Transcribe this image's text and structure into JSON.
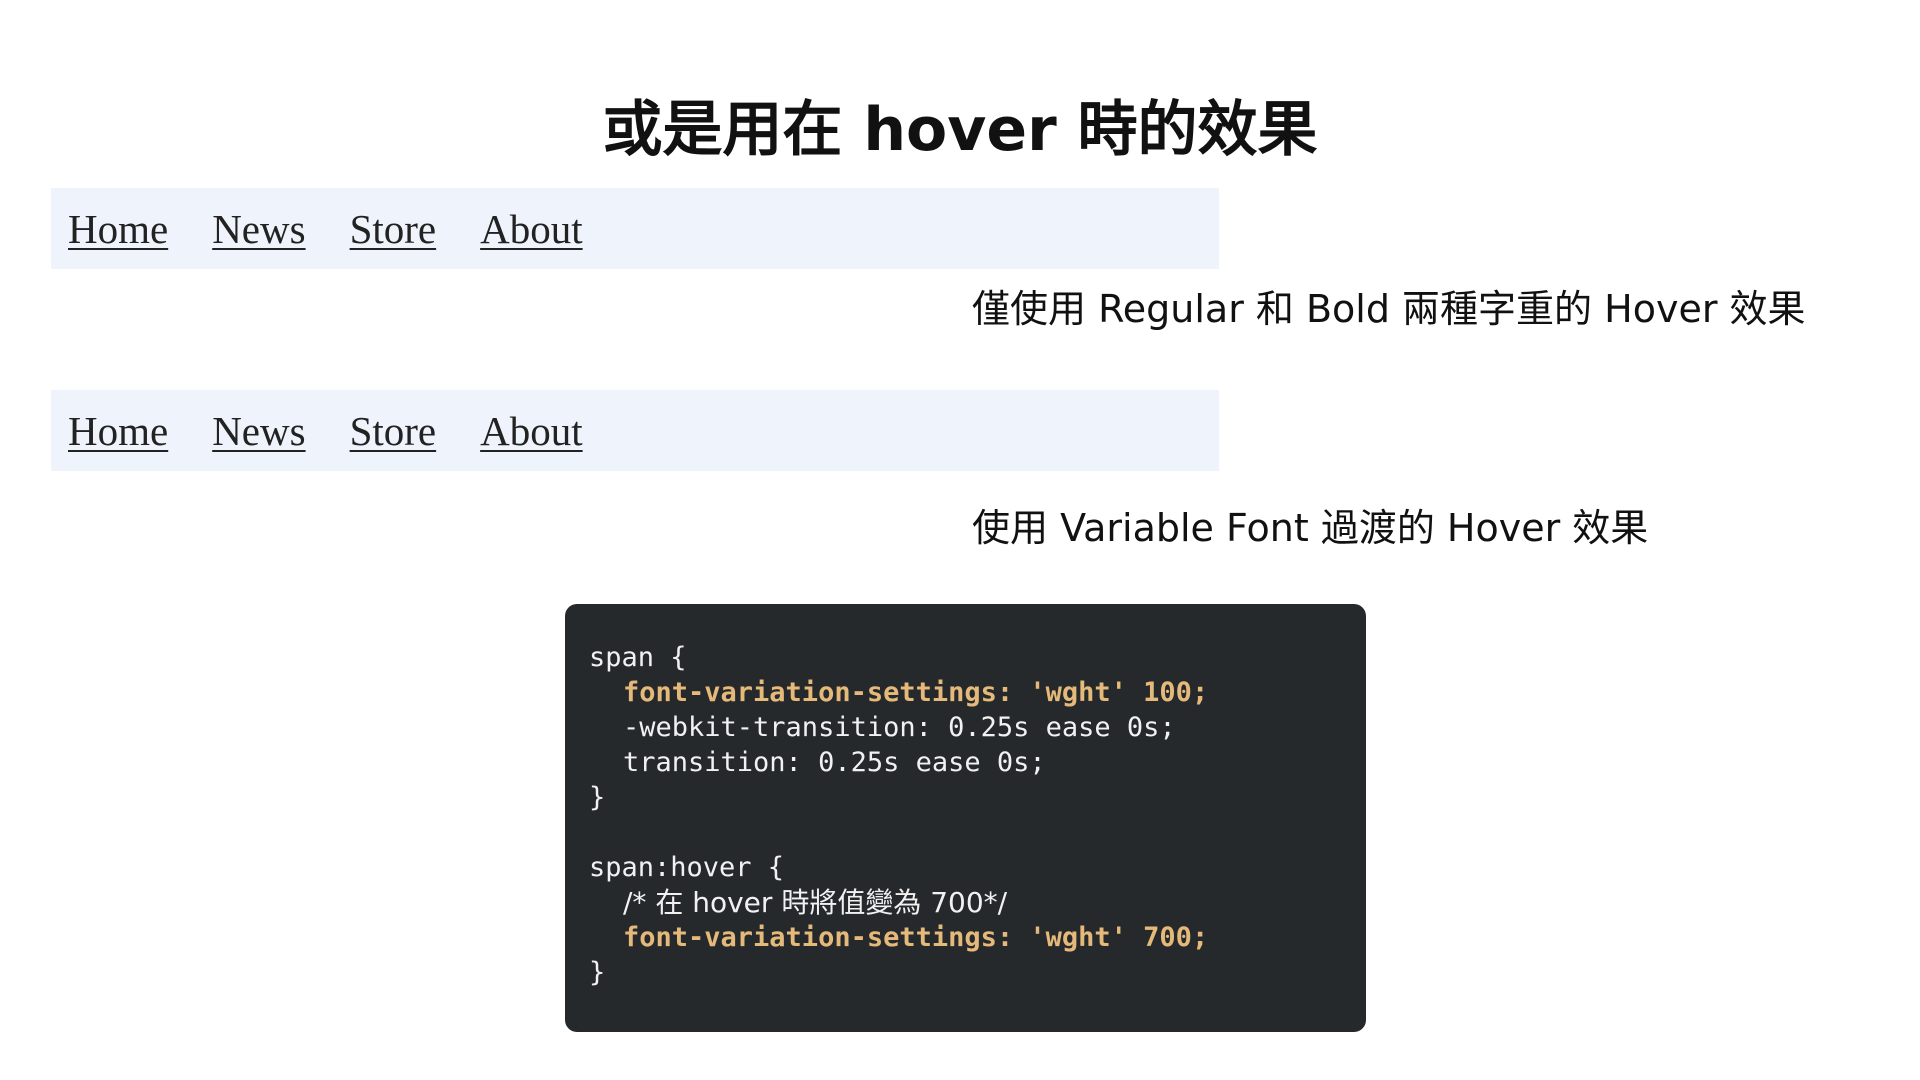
{
  "title": "或是用在 hover 時的效果",
  "nav_regular": {
    "items": [
      {
        "label": "Home"
      },
      {
        "label": "News"
      },
      {
        "label": "Store"
      },
      {
        "label": "About"
      }
    ],
    "caption": "僅使用 Regular 和 Bold 兩種字重的 Hover 效果"
  },
  "nav_variable": {
    "items": [
      {
        "label": "Home"
      },
      {
        "label": "News"
      },
      {
        "label": "Store"
      },
      {
        "label": "About"
      }
    ],
    "caption": "使用 Variable Font 過渡的 Hover 效果"
  },
  "code": {
    "lines": [
      "span {",
      "font-variation-settings: 'wght' 100;",
      "-webkit-transition: 0.25s ease 0s;",
      "transition: 0.25s ease 0s;",
      "}",
      "",
      "span:hover {",
      "/* 在 hover 時將值變為 700*/",
      "font-variation-settings: 'wght' 700;",
      "}"
    ]
  },
  "colors": {
    "background": "#ffffff",
    "nav_background": "#eff4fc",
    "code_background": "#26292c",
    "code_text": "#f1f1f1",
    "code_highlight": "#e5b97a"
  }
}
